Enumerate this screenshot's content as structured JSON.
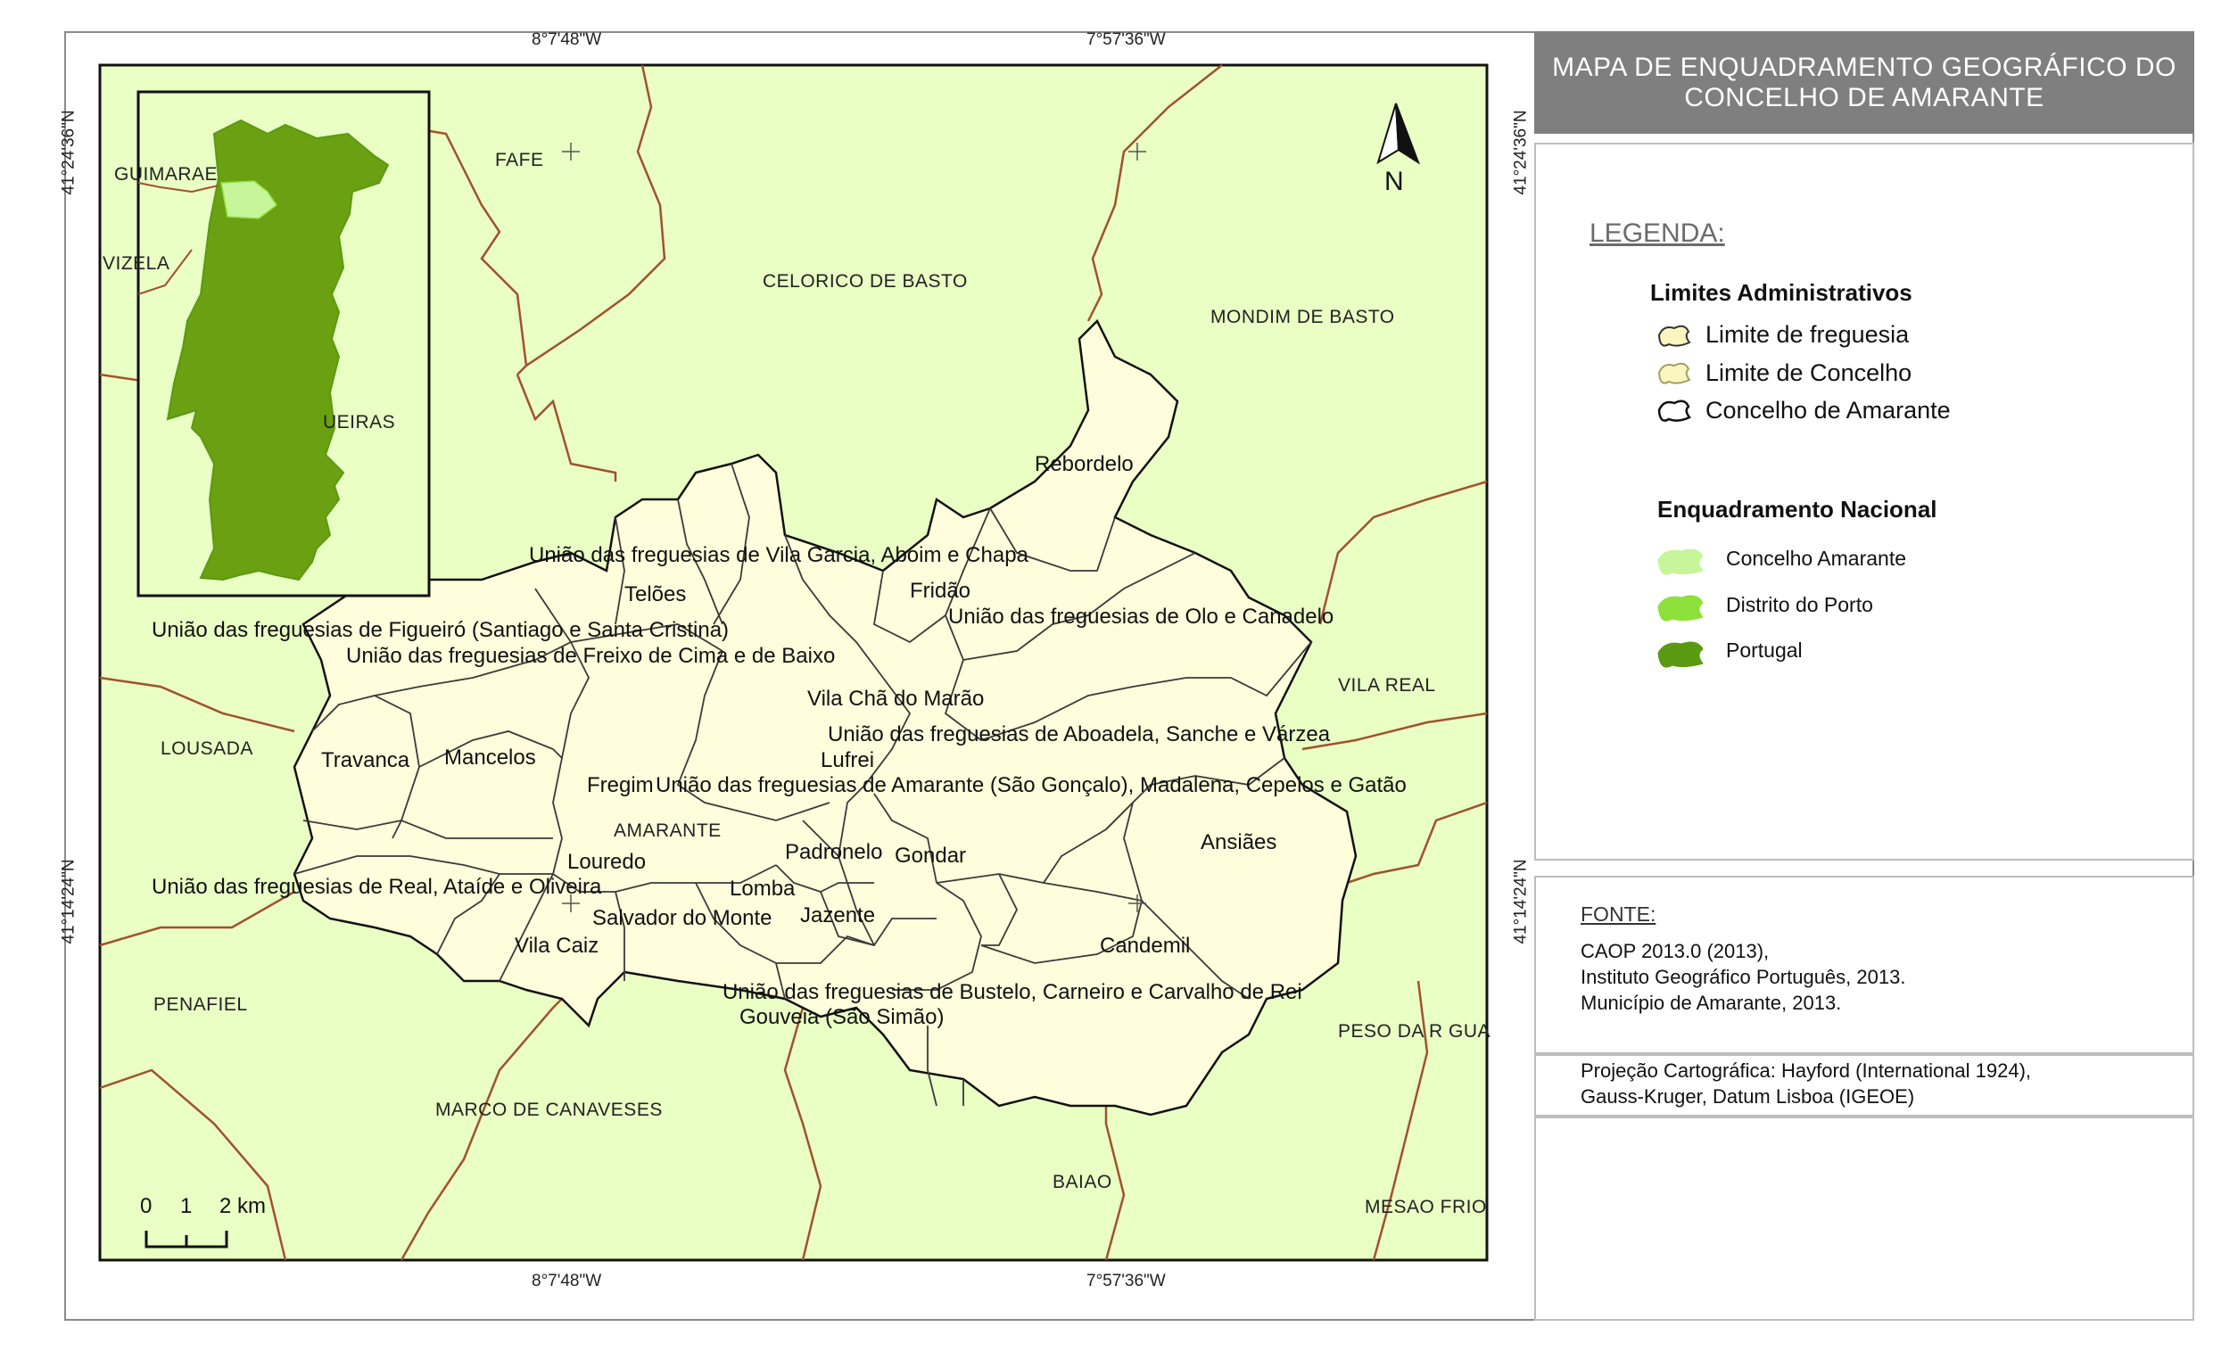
{
  "title": "MAPA DE ENQUADRAMENTO  GEOGRÁFICO DO\nCONCELHO DE AMARANTE",
  "coordinates": {
    "top_left": "8°7'48\"W",
    "top_right": "7°57'36\"W",
    "bottom_left": "8°7'48\"W",
    "bottom_right": "7°57'36\"W",
    "left_upper": "41°24'36\"N",
    "left_lower": "41°14'24\"N",
    "right_upper": "41°24'36\"N",
    "right_lower": "41°14'24\"N"
  },
  "north_arrow": "N",
  "scale_bar": {
    "labels": [
      "0",
      "1",
      "2 km"
    ]
  },
  "neighbors": [
    {
      "id": "fafe",
      "label": "FAFE"
    },
    {
      "id": "celorico",
      "label": "CELORICO DE BASTO"
    },
    {
      "id": "mondim",
      "label": "MONDIM DE BASTO"
    },
    {
      "id": "vilareal",
      "label": "VILA REAL"
    },
    {
      "id": "lousada",
      "label": "LOUSADA"
    },
    {
      "id": "penafiel",
      "label": "PENAFIEL"
    },
    {
      "id": "marco",
      "label": "MARCO DE CANAVESES"
    },
    {
      "id": "baiao",
      "label": "BAIAO"
    },
    {
      "id": "peso",
      "label": "PESO DA R GUA"
    },
    {
      "id": "mesao",
      "label": "MESAO FRIO"
    },
    {
      "id": "amarante",
      "label": "AMARANTE"
    }
  ],
  "inset_labels": [
    {
      "id": "guimaraes",
      "label": "GUIMARAE"
    },
    {
      "id": "vizela",
      "label": "VIZELA"
    },
    {
      "id": "felgueiras",
      "label": "UEIRAS"
    }
  ],
  "parishes": [
    {
      "id": "rebordelo",
      "label": "Rebordelo"
    },
    {
      "id": "vila-garcia",
      "label": "União das freguesias de Vila Garcia, Aboim e Chapa"
    },
    {
      "id": "teloes",
      "label": "Telões"
    },
    {
      "id": "fridao",
      "label": "Fridão"
    },
    {
      "id": "olo",
      "label": "União das freguesias de Olo e Canadelo"
    },
    {
      "id": "figueiro",
      "label": "União das freguesias de Figueiró (Santiago e Santa Cristina)"
    },
    {
      "id": "freixo",
      "label": "União das freguesias de Freixo de Cima e de Baixo"
    },
    {
      "id": "vila-cha",
      "label": "Vila Chã do Marão"
    },
    {
      "id": "aboadela",
      "label": "União das freguesias de Aboadela, Sanche e Várzea"
    },
    {
      "id": "travanca",
      "label": "Travanca"
    },
    {
      "id": "mancelos",
      "label": "Mancelos"
    },
    {
      "id": "lufrei",
      "label": "Lufrei"
    },
    {
      "id": "fregim",
      "label": "Fregim"
    },
    {
      "id": "amarante-sg",
      "label": "União das freguesias de Amarante (São Gonçalo), Madalena, Cepelos e Gatão"
    },
    {
      "id": "ansiaes",
      "label": "Ansiães"
    },
    {
      "id": "louredo",
      "label": "Louredo"
    },
    {
      "id": "padronelo",
      "label": "Padronelo"
    },
    {
      "id": "gondar",
      "label": "Gondar"
    },
    {
      "id": "real",
      "label": "União das freguesias de Real, Ataíde e Oliveira"
    },
    {
      "id": "lomba",
      "label": "Lomba"
    },
    {
      "id": "salvador",
      "label": "Salvador do Monte"
    },
    {
      "id": "jazente",
      "label": "Jazente"
    },
    {
      "id": "vila-caiz",
      "label": "Vila Caiz"
    },
    {
      "id": "candemil",
      "label": "Candemil"
    },
    {
      "id": "bustelo",
      "label": "União das freguesias de Bustelo, Carneiro e Carvalho de Rei"
    },
    {
      "id": "gouveia",
      "label": "Gouveia (São Simão)"
    }
  ],
  "legend": {
    "heading": "LEGENDA:",
    "admin_heading": "Limites Administrativos",
    "admin_items": [
      {
        "label": "Limite de freguesia",
        "fill": "#fbf6bf",
        "stroke": "#333333"
      },
      {
        "label": "Limite de Concelho",
        "fill": "#fbf6bf",
        "stroke": "#a0a060"
      },
      {
        "label": "Concelho de Amarante",
        "fill": "#ffffff",
        "stroke": "#111111"
      }
    ],
    "national_heading": "Enquadramento Nacional",
    "national_items": [
      {
        "label": "Concelho Amarante",
        "fill": "#c7f59a"
      },
      {
        "label": "Distrito do Porto",
        "fill": "#8ee03a"
      },
      {
        "label": "Portugal",
        "fill": "#5a9a12"
      }
    ]
  },
  "source": {
    "heading": "FONTE:",
    "text": "CAOP 2013.0 (2013),\nInstituto Geográfico Português, 2013.\nMunicípio de Amarante, 2013."
  },
  "projection": "Projeção Cartográfica: Hayford (International 1924),\nGauss-Kruger, Datum Lisboa (IGEOE)",
  "colors": {
    "background_land": "#e9ffc4",
    "amarante_fill": "#fffddb",
    "boundary": "#a0522d",
    "portugal": "#6aa012",
    "porto_district": "#c7f59a",
    "title_bg": "#7f7f7f"
  }
}
